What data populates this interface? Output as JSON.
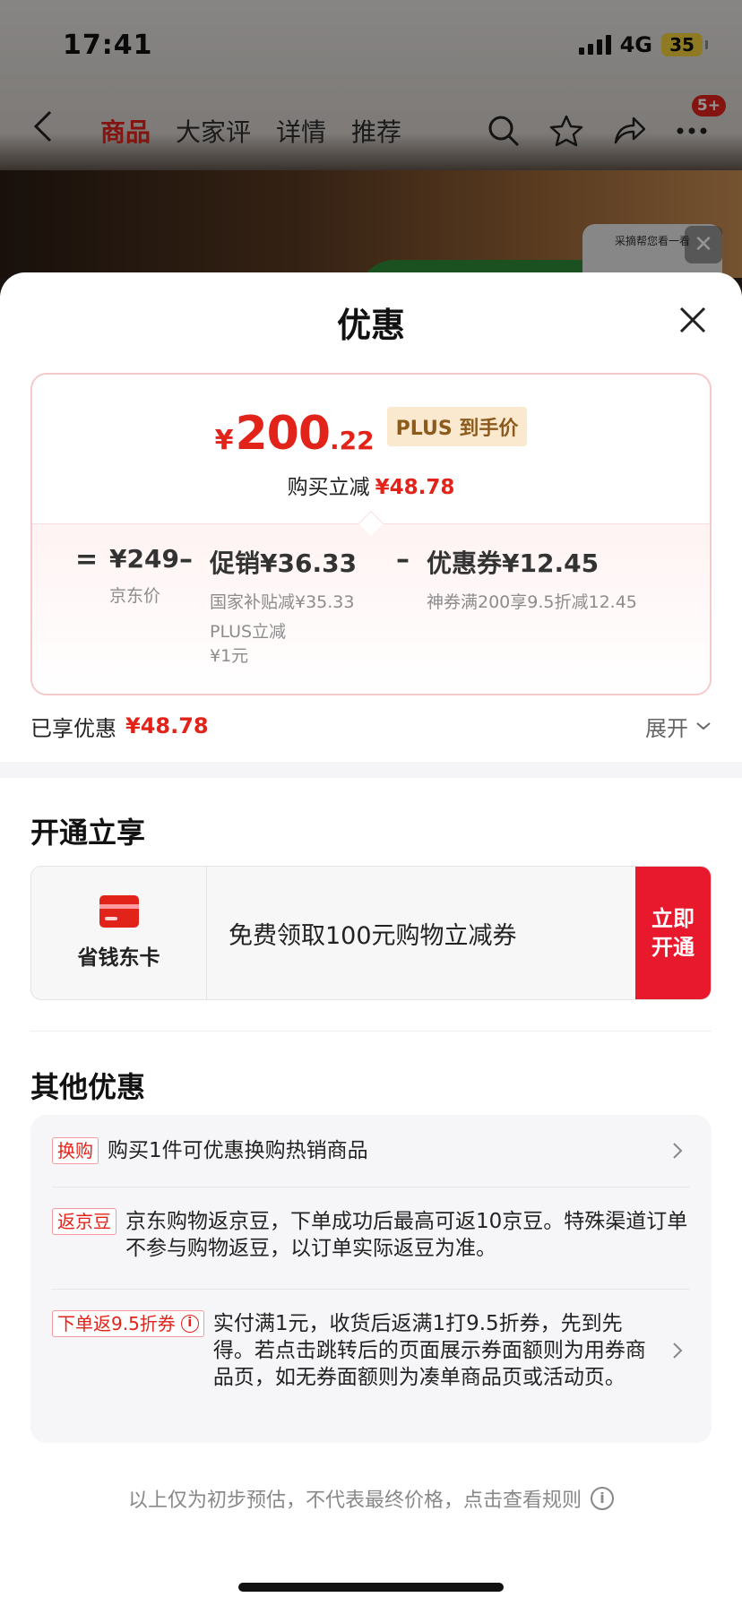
{
  "status_bar": {
    "time": "17:41",
    "network": "4G",
    "battery": "35"
  },
  "nav": {
    "tabs": [
      "商品",
      "大家评",
      "详情",
      "推荐"
    ],
    "badge": "5+"
  },
  "video_thumb": {
    "label": "采摘帮您看一看"
  },
  "sheet": {
    "title": "优惠",
    "price": {
      "yen": "¥",
      "int": "200",
      "dec": ".22",
      "tag": "PLUS 到手价"
    },
    "instant": {
      "label": "购买立减",
      "value": "¥48.78"
    },
    "calc": {
      "op_eq": "=",
      "op_minus1": "–",
      "op_minus2": "–",
      "jd_price": "¥249",
      "jd_price_label": "京东价",
      "promo_head": "促销¥36.33",
      "promo_sub1": "国家补贴减¥35.33",
      "promo_sub2": "PLUS立减",
      "promo_sub3": "¥1元",
      "coupon_head": "优惠券¥12.45",
      "coupon_sub": "神券满200享9.5折减12.45"
    },
    "enjoyed": {
      "label": "已享优惠",
      "value": "¥48.78",
      "expand": "展开"
    },
    "open_section": {
      "title": "开通立享",
      "card_name": "省钱东卡",
      "card_text": "免费领取100元购物立减券",
      "button": "立即开通"
    },
    "other_section": {
      "title": "其他优惠",
      "offers": [
        {
          "tag": "换购",
          "text": "购买1件可优惠换购热销商品"
        },
        {
          "tag": "返京豆",
          "text": "京东购物返京豆，下单成功后最高可返10京豆。特殊渠道订单不参与购物返豆，以订单实际返豆为准。"
        },
        {
          "tag": "下单返9.5折券",
          "text": "实付满1元，收货后返满1打9.5折券，先到先得。若点击跳转后的页面展示券面额则为用券商品页，如无券面额则为凑单商品页或活动页。"
        }
      ]
    },
    "footer": "以上仅为初步预估，不代表最终价格，点击查看规则"
  },
  "colors": {
    "accent": "#e2231a",
    "plus_tag_bg": "#fbe9cf"
  },
  "icons": [
    "back-icon",
    "search-icon",
    "star-icon",
    "share-icon",
    "more-icon",
    "close-icon",
    "card-icon",
    "chevron-right-icon",
    "chevron-down-icon",
    "info-icon"
  ]
}
